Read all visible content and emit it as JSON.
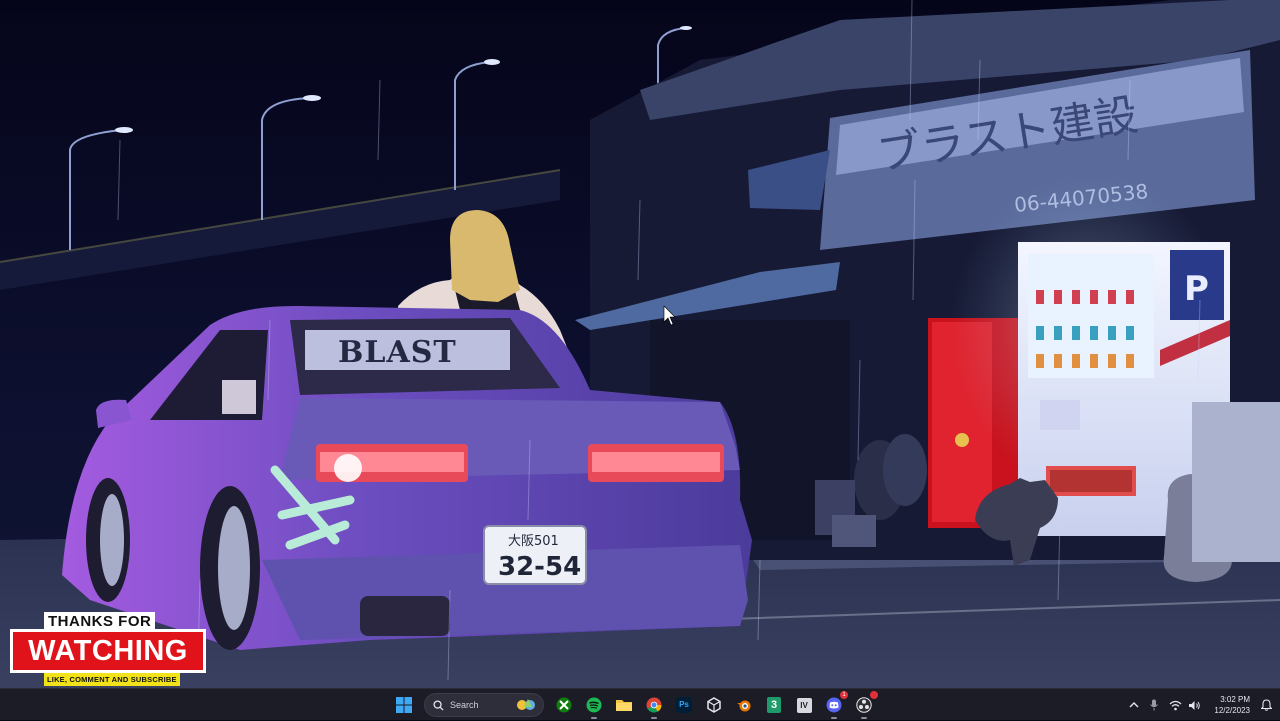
{
  "wallpaper": {
    "shop_sign": "ブラスト建設",
    "shop_phone": "06-44070538",
    "windshield_banner": "BLAST",
    "plate_top": "大阪501",
    "plate_number": "32-54",
    "vending_brand": "P"
  },
  "overlay": {
    "top_line": "THANKS FOR",
    "main": "WATCHING",
    "sub": "LIKE, COMMENT AND SUBSCRIBE"
  },
  "taskbar": {
    "search_placeholder": "Search",
    "apps": [
      {
        "name": "start",
        "icon": "windows-icon"
      },
      {
        "name": "search",
        "icon": "search-icon"
      },
      {
        "name": "xbox",
        "icon": "xbox-icon"
      },
      {
        "name": "spotify",
        "icon": "spotify-icon"
      },
      {
        "name": "file-explorer",
        "icon": "folder-icon"
      },
      {
        "name": "chrome",
        "icon": "chrome-icon"
      },
      {
        "name": "photoshop",
        "icon": "photoshop-icon",
        "label": "Ps"
      },
      {
        "name": "unity",
        "icon": "unity-icon"
      },
      {
        "name": "blender",
        "icon": "blender-icon"
      },
      {
        "name": "3",
        "icon": "green-3-icon",
        "label": "3"
      },
      {
        "name": "iv",
        "icon": "iv-icon",
        "label": "IV"
      },
      {
        "name": "discord",
        "icon": "discord-icon",
        "badge": "1"
      },
      {
        "name": "obs",
        "icon": "obs-icon"
      }
    ],
    "tray": {
      "clock_time": "3:02 PM",
      "clock_date": "12/2/2023"
    }
  },
  "colors": {
    "taskbar_bg": "#1c1c26",
    "badge_red": "#e0131a",
    "badge_yellow": "#f2e21a",
    "spotify_green": "#1db954",
    "xbox_green": "#107c10"
  }
}
